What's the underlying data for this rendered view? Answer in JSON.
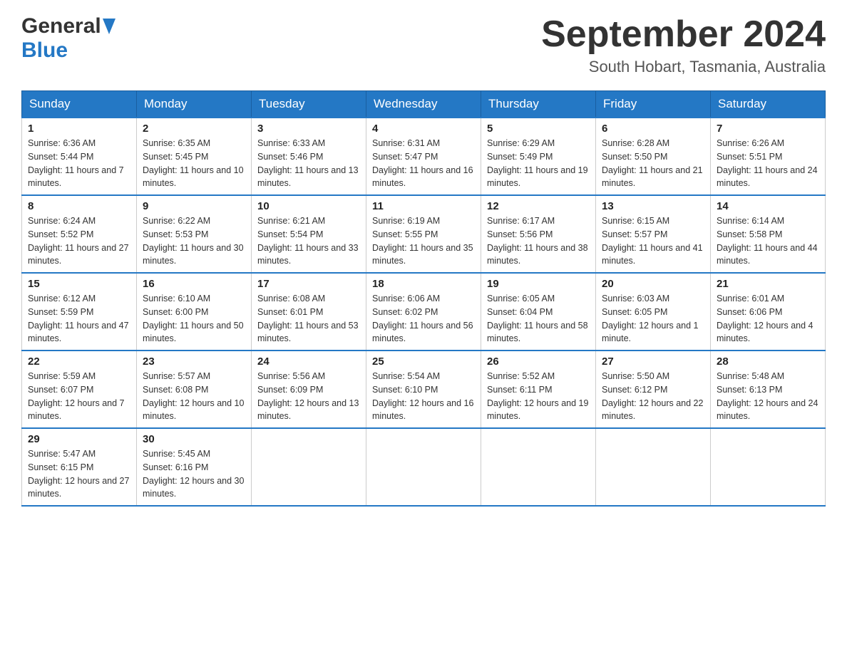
{
  "header": {
    "logo": {
      "general": "General",
      "triangle": "▶",
      "blue": "Blue"
    },
    "title": "September 2024",
    "location": "South Hobart, Tasmania, Australia"
  },
  "weekdays": [
    "Sunday",
    "Monday",
    "Tuesday",
    "Wednesday",
    "Thursday",
    "Friday",
    "Saturday"
  ],
  "weeks": [
    [
      {
        "day": "1",
        "sunrise": "6:36 AM",
        "sunset": "5:44 PM",
        "daylight": "11 hours and 7 minutes."
      },
      {
        "day": "2",
        "sunrise": "6:35 AM",
        "sunset": "5:45 PM",
        "daylight": "11 hours and 10 minutes."
      },
      {
        "day": "3",
        "sunrise": "6:33 AM",
        "sunset": "5:46 PM",
        "daylight": "11 hours and 13 minutes."
      },
      {
        "day": "4",
        "sunrise": "6:31 AM",
        "sunset": "5:47 PM",
        "daylight": "11 hours and 16 minutes."
      },
      {
        "day": "5",
        "sunrise": "6:29 AM",
        "sunset": "5:49 PM",
        "daylight": "11 hours and 19 minutes."
      },
      {
        "day": "6",
        "sunrise": "6:28 AM",
        "sunset": "5:50 PM",
        "daylight": "11 hours and 21 minutes."
      },
      {
        "day": "7",
        "sunrise": "6:26 AM",
        "sunset": "5:51 PM",
        "daylight": "11 hours and 24 minutes."
      }
    ],
    [
      {
        "day": "8",
        "sunrise": "6:24 AM",
        "sunset": "5:52 PM",
        "daylight": "11 hours and 27 minutes."
      },
      {
        "day": "9",
        "sunrise": "6:22 AM",
        "sunset": "5:53 PM",
        "daylight": "11 hours and 30 minutes."
      },
      {
        "day": "10",
        "sunrise": "6:21 AM",
        "sunset": "5:54 PM",
        "daylight": "11 hours and 33 minutes."
      },
      {
        "day": "11",
        "sunrise": "6:19 AM",
        "sunset": "5:55 PM",
        "daylight": "11 hours and 35 minutes."
      },
      {
        "day": "12",
        "sunrise": "6:17 AM",
        "sunset": "5:56 PM",
        "daylight": "11 hours and 38 minutes."
      },
      {
        "day": "13",
        "sunrise": "6:15 AM",
        "sunset": "5:57 PM",
        "daylight": "11 hours and 41 minutes."
      },
      {
        "day": "14",
        "sunrise": "6:14 AM",
        "sunset": "5:58 PM",
        "daylight": "11 hours and 44 minutes."
      }
    ],
    [
      {
        "day": "15",
        "sunrise": "6:12 AM",
        "sunset": "5:59 PM",
        "daylight": "11 hours and 47 minutes."
      },
      {
        "day": "16",
        "sunrise": "6:10 AM",
        "sunset": "6:00 PM",
        "daylight": "11 hours and 50 minutes."
      },
      {
        "day": "17",
        "sunrise": "6:08 AM",
        "sunset": "6:01 PM",
        "daylight": "11 hours and 53 minutes."
      },
      {
        "day": "18",
        "sunrise": "6:06 AM",
        "sunset": "6:02 PM",
        "daylight": "11 hours and 56 minutes."
      },
      {
        "day": "19",
        "sunrise": "6:05 AM",
        "sunset": "6:04 PM",
        "daylight": "11 hours and 58 minutes."
      },
      {
        "day": "20",
        "sunrise": "6:03 AM",
        "sunset": "6:05 PM",
        "daylight": "12 hours and 1 minute."
      },
      {
        "day": "21",
        "sunrise": "6:01 AM",
        "sunset": "6:06 PM",
        "daylight": "12 hours and 4 minutes."
      }
    ],
    [
      {
        "day": "22",
        "sunrise": "5:59 AM",
        "sunset": "6:07 PM",
        "daylight": "12 hours and 7 minutes."
      },
      {
        "day": "23",
        "sunrise": "5:57 AM",
        "sunset": "6:08 PM",
        "daylight": "12 hours and 10 minutes."
      },
      {
        "day": "24",
        "sunrise": "5:56 AM",
        "sunset": "6:09 PM",
        "daylight": "12 hours and 13 minutes."
      },
      {
        "day": "25",
        "sunrise": "5:54 AM",
        "sunset": "6:10 PM",
        "daylight": "12 hours and 16 minutes."
      },
      {
        "day": "26",
        "sunrise": "5:52 AM",
        "sunset": "6:11 PM",
        "daylight": "12 hours and 19 minutes."
      },
      {
        "day": "27",
        "sunrise": "5:50 AM",
        "sunset": "6:12 PM",
        "daylight": "12 hours and 22 minutes."
      },
      {
        "day": "28",
        "sunrise": "5:48 AM",
        "sunset": "6:13 PM",
        "daylight": "12 hours and 24 minutes."
      }
    ],
    [
      {
        "day": "29",
        "sunrise": "5:47 AM",
        "sunset": "6:15 PM",
        "daylight": "12 hours and 27 minutes."
      },
      {
        "day": "30",
        "sunrise": "5:45 AM",
        "sunset": "6:16 PM",
        "daylight": "12 hours and 30 minutes."
      },
      null,
      null,
      null,
      null,
      null
    ]
  ],
  "labels": {
    "sunrise": "Sunrise:",
    "sunset": "Sunset:",
    "daylight": "Daylight:"
  }
}
